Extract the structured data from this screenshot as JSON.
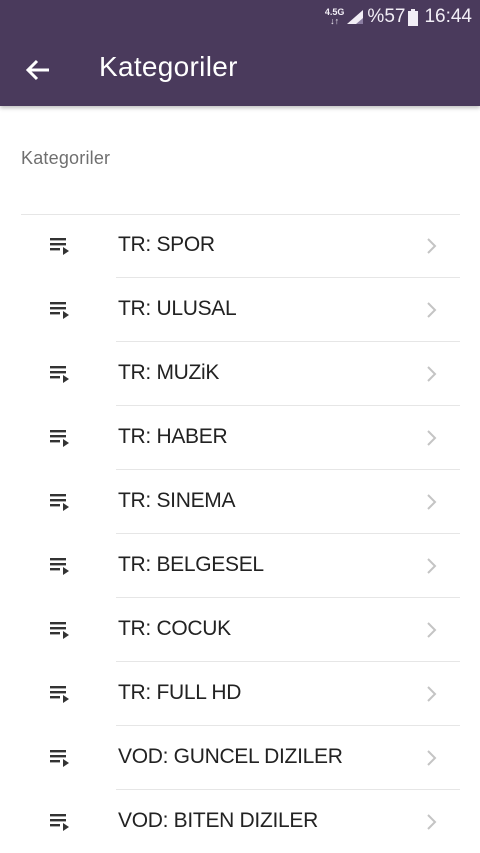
{
  "status_bar": {
    "network_top": "4.5G",
    "network_bottom": "↓↑",
    "battery_percent": "%57",
    "time": "16:44"
  },
  "app_bar": {
    "title": "Kategoriler",
    "back_icon": "arrow-left-icon"
  },
  "section": {
    "title": "Kategoriler"
  },
  "categories": [
    {
      "label": "TR: SPOR"
    },
    {
      "label": "TR: ULUSAL"
    },
    {
      "label": "TR: MUZiK"
    },
    {
      "label": "TR: HABER"
    },
    {
      "label": "TR: SINEMA"
    },
    {
      "label": "TR: BELGESEL"
    },
    {
      "label": "TR: COCUK"
    },
    {
      "label": "TR: FULL HD"
    },
    {
      "label": "VOD: GUNCEL DIZILER"
    },
    {
      "label": "VOD: BITEN DIZILER"
    }
  ],
  "icons": {
    "item_icon": "playlist-play-icon",
    "chevron": "chevron-right-icon"
  },
  "colors": {
    "header_bg": "#4a3a5c",
    "header_text": "#ffffff",
    "item_text": "#222222",
    "section_text": "#6f6f6f",
    "chevron": "#c4c4c4",
    "divider": "#e6e6e6"
  }
}
